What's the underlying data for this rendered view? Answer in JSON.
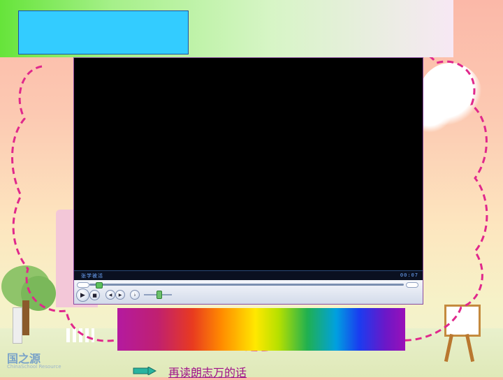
{
  "banner": {
    "box_color": "#33ccff"
  },
  "player": {
    "title": "张学被活",
    "time": "00:07",
    "play_icon": "play-icon",
    "stop_icon": "stop-icon",
    "prev_icon": "previous-icon",
    "next_icon": "next-icon",
    "mute_icon": "speaker-icon",
    "seek_progress": 0.02
  },
  "logo": {
    "name": "国之源",
    "subtitle": "ChinaSchool Resource"
  },
  "nav": {
    "link_label": "再读朗志万的话",
    "arrow_icon": "arrow-right-icon"
  },
  "colors": {
    "accent": "#a0108a",
    "dashed_outline": "#e0288c"
  }
}
